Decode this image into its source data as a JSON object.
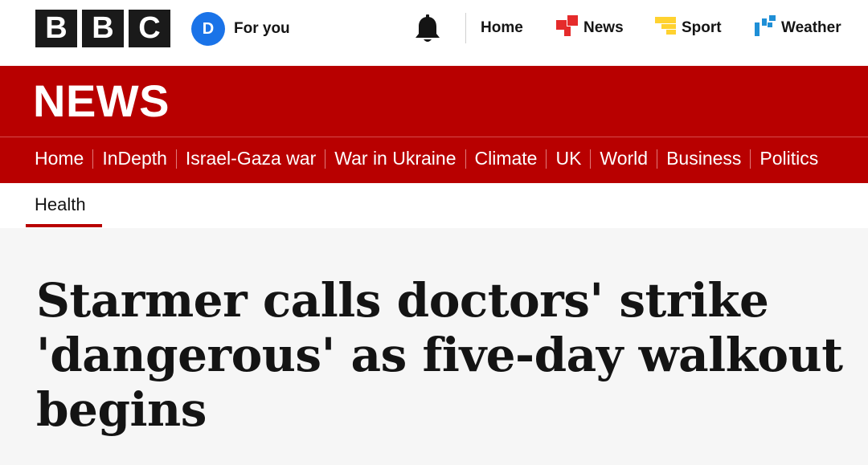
{
  "header": {
    "logo_letters": [
      "B",
      "B",
      "C"
    ],
    "user": {
      "avatar_letter": "D",
      "label": "For you"
    },
    "nav": [
      {
        "label": "Home",
        "icon": ""
      },
      {
        "label": "News",
        "icon": "news-icon"
      },
      {
        "label": "Sport",
        "icon": "sport-icon"
      },
      {
        "label": "Weather",
        "icon": "weather-icon"
      }
    ],
    "notification_icon": "bell-icon"
  },
  "news_band": {
    "title": "NEWS",
    "sections": [
      "Home",
      "InDepth",
      "Israel-Gaza war",
      "War in Ukraine",
      "Climate",
      "UK",
      "World",
      "Business",
      "Politics"
    ]
  },
  "subnav": {
    "active": "Health"
  },
  "article": {
    "headline": "Starmer calls doctors' strike 'dangerous' as five-day walkout begins"
  },
  "colors": {
    "brand_red": "#b80000",
    "avatar_blue": "#1a73e8",
    "news_icon_red": "#e52b2b",
    "sport_icon_yellow": "#ffd230",
    "weather_icon_blue": "#1f8fd6"
  }
}
